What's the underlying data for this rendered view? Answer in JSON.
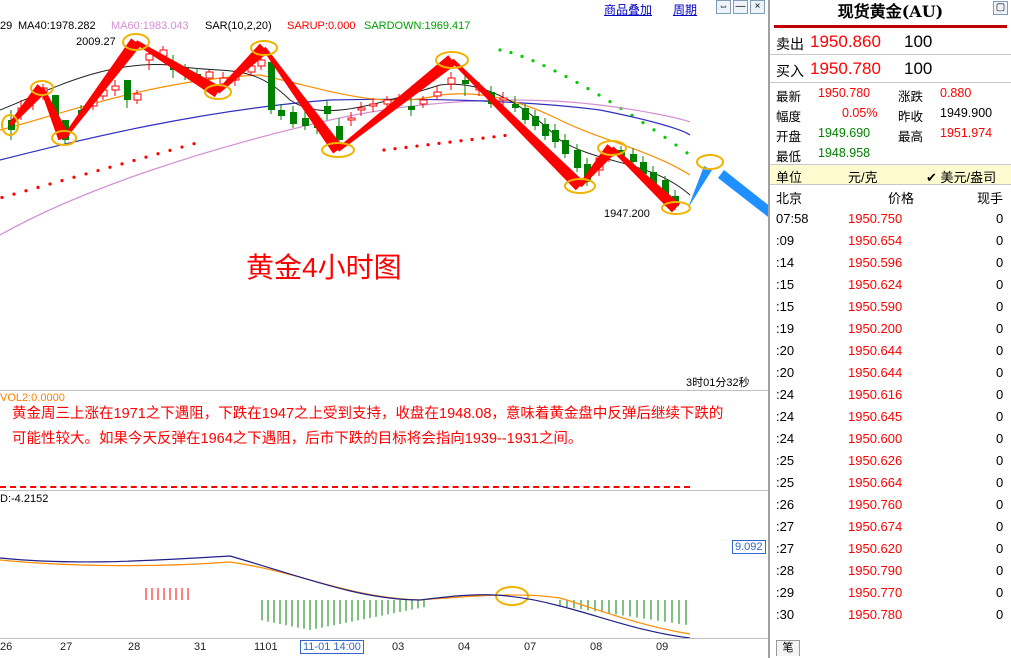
{
  "toolbar": {
    "ma_info_a": "29",
    "ma40": "MA40:1978.282",
    "ma60": "MA60:1983.043",
    "sar": "SAR(10,2,20)",
    "sarup": "SARUP:0.000",
    "sardown": "SARDOWN:1969.417",
    "overlay_link": "商品叠加",
    "period_link": "周期",
    "btn_restore": "⇔",
    "btn_minus": "—",
    "btn_close": "×"
  },
  "chart": {
    "high_label": "2009.27",
    "low_label": "1947.200",
    "title": "黄金4小时图",
    "countdown": "3时01分32秒",
    "vol_label": "VOL2:0.0000",
    "note": "黄金周三上涨在1971之下遇阻，下跌在1947之上受到支持，收盘在1948.08，意味着黄金盘中反弹后继续下跌的可能性较大。如果今天反弹在1964之下遇阻，后市下跌的目标将会指向1939--1931之间。",
    "macd_label": "D:-4.2152",
    "macd_value": "9.092",
    "x_labels": [
      "26",
      "27",
      "28",
      "31",
      "1101",
      "11-01 14:00",
      "03",
      "04",
      "07",
      "08",
      "09"
    ]
  },
  "colors": {
    "up": "#ff0000",
    "down": "#008000",
    "accent": "#ff0000",
    "highlight": "#f0b400",
    "arrow_blue": "#1e90ff"
  },
  "quote": {
    "title": "现货黄金(AU)",
    "sell_label": "卖出",
    "sell_price": "1950.860",
    "sell_vol": "100",
    "buy_label": "买入",
    "buy_price": "1950.780",
    "buy_vol": "100",
    "latest_label": "最新",
    "latest": "1950.780",
    "change_label": "涨跌",
    "change": "0.880",
    "amp_label": "幅度",
    "amp": "0.05%",
    "prev_label": "昨收",
    "prev": "1949.900",
    "open_label": "开盘",
    "open": "1949.690",
    "high_label": "最高",
    "high": "1951.974",
    "low_label": "最低",
    "low": "1948.958",
    "unit_label": "单位",
    "unit": "元/克",
    "unit_alt": "✔ 美元/盎司",
    "col_time": "北京",
    "col_price": "价格",
    "col_vol": "现手",
    "pen": "笔"
  },
  "ticks": [
    {
      "t": "07:58",
      "p": "1950.750",
      "v": "0"
    },
    {
      "t": ":09",
      "p": "1950.654",
      "v": "0"
    },
    {
      "t": ":14",
      "p": "1950.596",
      "v": "0"
    },
    {
      "t": ":15",
      "p": "1950.624",
      "v": "0"
    },
    {
      "t": ":15",
      "p": "1950.590",
      "v": "0"
    },
    {
      "t": ":19",
      "p": "1950.200",
      "v": "0"
    },
    {
      "t": ":20",
      "p": "1950.644",
      "v": "0"
    },
    {
      "t": ":20",
      "p": "1950.644",
      "v": "0"
    },
    {
      "t": ":24",
      "p": "1950.616",
      "v": "0"
    },
    {
      "t": ":24",
      "p": "1950.645",
      "v": "0"
    },
    {
      "t": ":24",
      "p": "1950.600",
      "v": "0"
    },
    {
      "t": ":25",
      "p": "1950.626",
      "v": "0"
    },
    {
      "t": ":25",
      "p": "1950.664",
      "v": "0"
    },
    {
      "t": ":26",
      "p": "1950.760",
      "v": "0"
    },
    {
      "t": ":27",
      "p": "1950.674",
      "v": "0"
    },
    {
      "t": ":27",
      "p": "1950.620",
      "v": "0"
    },
    {
      "t": ":28",
      "p": "1950.790",
      "v": "0"
    },
    {
      "t": ":29",
      "p": "1950.770",
      "v": "0"
    },
    {
      "t": ":30",
      "p": "1950.780",
      "v": "0"
    }
  ]
}
